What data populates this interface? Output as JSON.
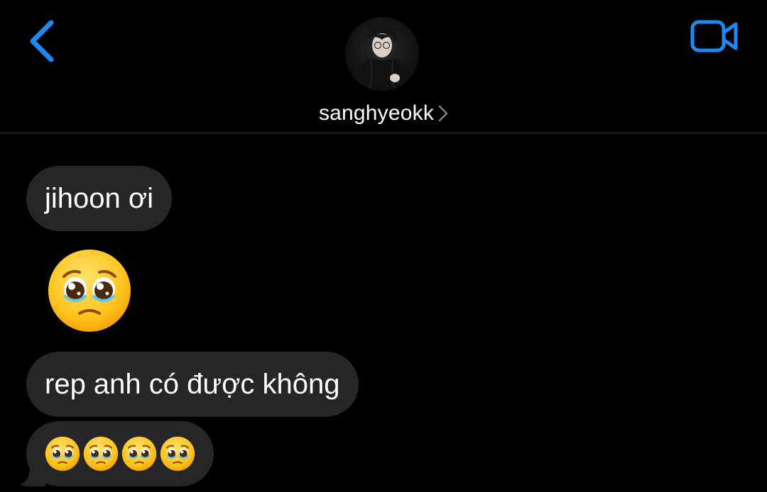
{
  "header": {
    "contact_name": "sanghyeokk",
    "back_icon": "chevron-left-icon",
    "video_icon": "video-camera-icon",
    "accent_color": "#1e88f5"
  },
  "messages": [
    {
      "type": "text",
      "text": "jihoon ơi"
    },
    {
      "type": "emoji",
      "emoji": "pleading-face",
      "count": 1
    },
    {
      "type": "text",
      "text": "rep anh có được không"
    },
    {
      "type": "emoji-text",
      "emoji": "pleading-face",
      "count": 4
    }
  ],
  "colors": {
    "background": "#000000",
    "bubble": "#262628",
    "text": "#ffffff"
  }
}
